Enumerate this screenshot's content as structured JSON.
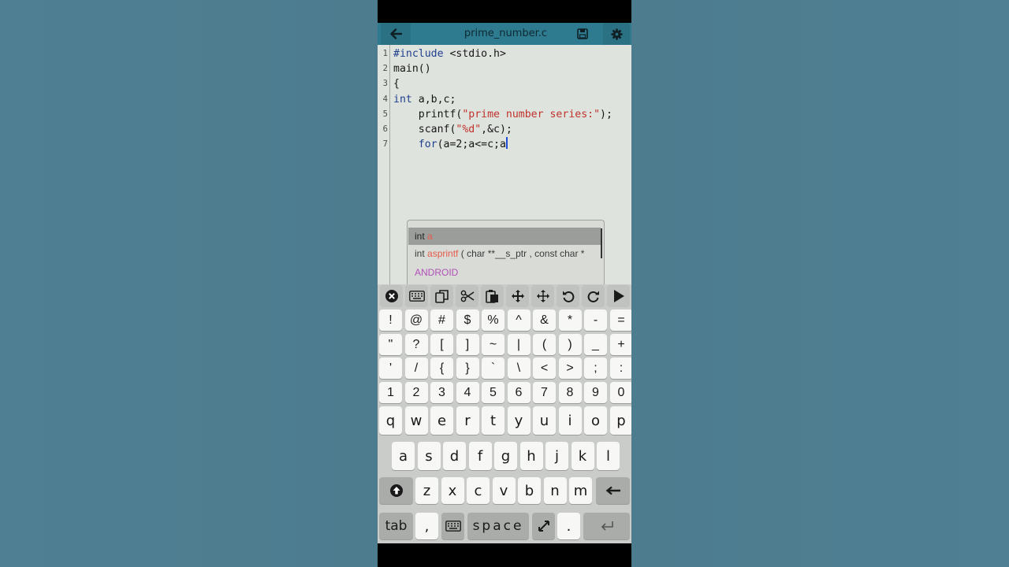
{
  "editor": {
    "filename": "prime_number.c",
    "lines": [
      {
        "num": "1",
        "segments": [
          {
            "t": "#include",
            "c": "kw"
          },
          {
            "t": " <stdio.h>",
            "c": ""
          }
        ]
      },
      {
        "num": "2",
        "segments": [
          {
            "t": "main()",
            "c": ""
          }
        ]
      },
      {
        "num": "3",
        "segments": [
          {
            "t": "{",
            "c": ""
          }
        ]
      },
      {
        "num": "4",
        "segments": [
          {
            "t": "int",
            "c": "kw"
          },
          {
            "t": " a,b,c;",
            "c": ""
          }
        ]
      },
      {
        "num": "5",
        "segments": [
          {
            "t": "    printf(",
            "c": ""
          },
          {
            "t": "\"prime number series:\"",
            "c": "str"
          },
          {
            "t": ");",
            "c": ""
          }
        ]
      },
      {
        "num": "6",
        "segments": [
          {
            "t": "    scanf(",
            "c": ""
          },
          {
            "t": "\"%d\"",
            "c": "str"
          },
          {
            "t": ",&c);",
            "c": ""
          }
        ]
      },
      {
        "num": "7",
        "segments": [
          {
            "t": "    ",
            "c": ""
          },
          {
            "t": "for",
            "c": "kw"
          },
          {
            "t": "(a=2;a<=c;a",
            "c": ""
          }
        ]
      }
    ]
  },
  "autocomplete": {
    "items": [
      {
        "type": "int",
        "name": "a",
        "sig": ""
      },
      {
        "type": "int",
        "name": "asprintf",
        "sig": "( char **__s_ptr ,  const char *"
      },
      {
        "type": "",
        "name": "ANDROID",
        "sig": ""
      }
    ]
  },
  "keyboard": {
    "row_symbols_1": [
      "!",
      "@",
      "#",
      "$",
      "%",
      "^",
      "&",
      "*",
      "-",
      "="
    ],
    "row_symbols_2": [
      "\"",
      "?",
      "[",
      "]",
      "~",
      "|",
      "(",
      ")",
      "_",
      "+"
    ],
    "row_symbols_3": [
      "'",
      "/",
      "{",
      "}",
      "`",
      "\\",
      "<",
      ">",
      ";",
      ":"
    ],
    "row_digits": [
      "1",
      "2",
      "3",
      "4",
      "5",
      "6",
      "7",
      "8",
      "9",
      "0"
    ],
    "row_letters_1": [
      "q",
      "w",
      "e",
      "r",
      "t",
      "y",
      "u",
      "i",
      "o",
      "p"
    ],
    "row_letters_2": [
      "a",
      "s",
      "d",
      "f",
      "g",
      "h",
      "j",
      "k",
      "l"
    ],
    "row_letters_3": [
      "z",
      "x",
      "c",
      "v",
      "b",
      "n",
      "m"
    ],
    "tab_label": "tab",
    "comma_label": ",",
    "space_label": "space",
    "period_label": "."
  },
  "icons": {
    "back": "arrow-left-icon",
    "save": "save-icon",
    "settings": "gear-icon"
  },
  "colors": {
    "titlebar": "#2e7a8e",
    "editor_bg": "#dfe3de",
    "keyword": "#1f3f8f",
    "string": "#c0322c",
    "cursor": "#1f4fd8"
  }
}
